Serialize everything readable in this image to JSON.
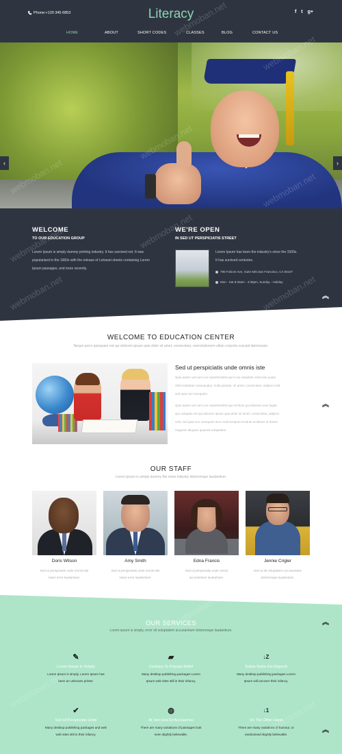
{
  "header": {
    "phone": "Phone:+120 345 6853",
    "logo": "Literacy",
    "social": [
      "f",
      "t",
      "g+"
    ],
    "nav": [
      "HOME",
      "ABOUT",
      "SHORT CODES",
      "CLASSES",
      "BLOG",
      "CONTACT US"
    ]
  },
  "info": {
    "welcome_title": "WELCOME",
    "welcome_sub": "TO OUR EDUCATION GROUP",
    "welcome_text": [
      "Lorem Ipsum is simply dummy printing industry. It has survived not. It was",
      "popularised in the 1960s with the release of Letraset sheets containing Lorem",
      "Ipsum passages, and more recently."
    ],
    "open_title": "WE'RE OPEN",
    "open_sub": "IN SED UT PERSPICIATIS STREET",
    "open_text": [
      "Lorem Ipsum has been the industry's since the 1500s.",
      "It has survived centuries."
    ],
    "address": "795 Folsom Ave, Suite 600,San Francisco, CA 94107",
    "hours": "Mon - Sat 8:30am - 4:30pm, Sunday - Holiday"
  },
  "welcome": {
    "title": "WELCOME TO EDUCATION CENTER",
    "subtitle": "Neque porro quisquam est qui dolorem ipsum quia dolor sit amet, consectetur, exercitationem ullam corporis suscipit laboriosam.",
    "heading": "Sed ut perspiciatis unde omnis iste",
    "para1": [
      "Quis autem vel eum iure reprehenderit qui in ea voluptate velit esse quam",
      "nihil molestiae consequatur, nulla pariatur. sit amet, consectetur, adipisci velit,",
      "sed quia non numquam."
    ],
    "para2": [
      "Quis autem vel eum iure reprehenderit qui vel illum qui dolorem eum fugiat",
      "quo voluptas est qui dolorem ipsum quia dolor sit amet, consectetur, adipisci",
      "velit, sed quia non numquam eius modi tempora incidunt ut labore et dolore",
      "magnam aliquam quaerat voluptatem."
    ]
  },
  "staff": {
    "title": "OUR STAFF",
    "subtitle": "Lorem Ipsum is simply dummy the news industry doloremque laudantium.",
    "members": [
      {
        "name": "Doris Wilson",
        "desc": [
          "Sed ut perspiciatis unde omnis iste",
          "natus error laudantium."
        ]
      },
      {
        "name": "Amy Smith",
        "desc": [
          "Sed ut perspiciatis unde omnis iste",
          "natus error laudantium."
        ]
      },
      {
        "name": "Edna Francis",
        "desc": [
          "Sed ut perspiciatis unde omnis",
          "accusantium laudantium."
        ]
      },
      {
        "name": "Jennie Crigler",
        "desc": [
          "Sed ut dit voluptatem accusantium",
          "doloremque laudantium."
        ]
      }
    ]
  },
  "services": {
    "title": "OUR SERVICES",
    "subtitle": "Lorem ipsum is simply, error sit voluptatem accusantium doloremque laudantium.",
    "items": [
      {
        "icon": "pencil-icon",
        "glyph": "✎",
        "title": "Lorem Ipsum Is Simply",
        "desc": [
          "Lorem Ipsum is simply. Lorem Ipsum has",
          "been an unknown printer."
        ]
      },
      {
        "icon": "folder-open-icon",
        "glyph": "▰",
        "title": "Contrary To Popular Belief",
        "desc": [
          "Many desktop publishing packages Lorem",
          "Ipsum web sites still in their infancy."
        ]
      },
      {
        "icon": "sort-alpha-icon",
        "glyph": "↓Z",
        "title": "Soluta Nobis Est Eligendi",
        "desc": [
          "Many desktop publishing packages Lorem",
          "Ipsum will uncover their infancy."
        ]
      },
      {
        "icon": "check-circle-icon",
        "glyph": "✔",
        "title": "Sed Ut Perspiciatis Unde",
        "desc": [
          "Many desktop publishing packages and web",
          "web sites still in their infancy."
        ]
      },
      {
        "icon": "globe-icon",
        "glyph": "◍",
        "title": "At Vero Eos Et Accusamus",
        "desc": [
          "There are many variations of passages look",
          "even slightly believable."
        ]
      },
      {
        "icon": "sort-numeric-icon",
        "glyph": "↓1",
        "title": "On The Other Hand",
        "desc": [
          "There are many variations of humour, or",
          "randomised slightly believable."
        ]
      }
    ]
  },
  "watermark": "webmoban.net",
  "colors": {
    "dark": "#2f3540",
    "accent": "#8fd4b6",
    "mint": "#aee5c8"
  }
}
